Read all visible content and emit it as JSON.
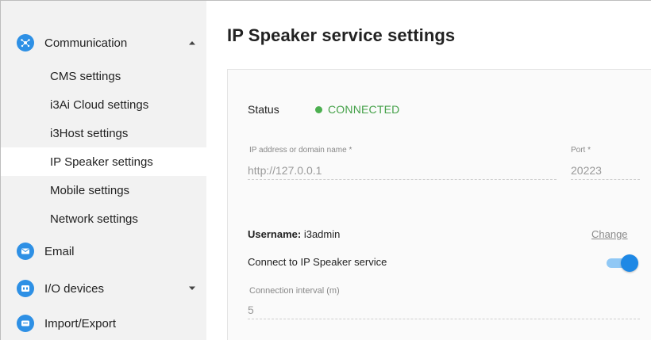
{
  "sidebar": {
    "groups": [
      {
        "label": "Communication",
        "icon": "communication-icon",
        "expanded": true
      },
      {
        "label": "Email",
        "icon": "email-icon"
      },
      {
        "label": "I/O devices",
        "icon": "io-devices-icon",
        "expanded": false
      },
      {
        "label": "Import/Export",
        "icon": "import-export-icon"
      }
    ],
    "communication_items": [
      {
        "label": "CMS settings"
      },
      {
        "label": "i3Ai Cloud settings"
      },
      {
        "label": "i3Host settings"
      },
      {
        "label": "IP Speaker settings",
        "active": true
      },
      {
        "label": "Mobile settings"
      },
      {
        "label": "Network settings"
      }
    ]
  },
  "main": {
    "title": "IP Speaker service settings",
    "status": {
      "label": "Status",
      "value": "CONNECTED",
      "color": "#43a047"
    },
    "ip_field": {
      "label": "IP address or domain name *",
      "value": "http://127.0.0.1"
    },
    "port_field": {
      "label": "Port *",
      "value": "20223"
    },
    "username": {
      "label": "Username:",
      "value": "i3admin"
    },
    "change_link": "Change",
    "connect": {
      "label": "Connect to IP Speaker service",
      "enabled": true
    },
    "interval_field": {
      "label": "Connection interval (m)",
      "value": "5"
    }
  },
  "colors": {
    "accent": "#1e88e5",
    "icon_blue": "#2e90e5",
    "sidebar_bg": "#f2f2f2",
    "status_green": "#43a047"
  }
}
